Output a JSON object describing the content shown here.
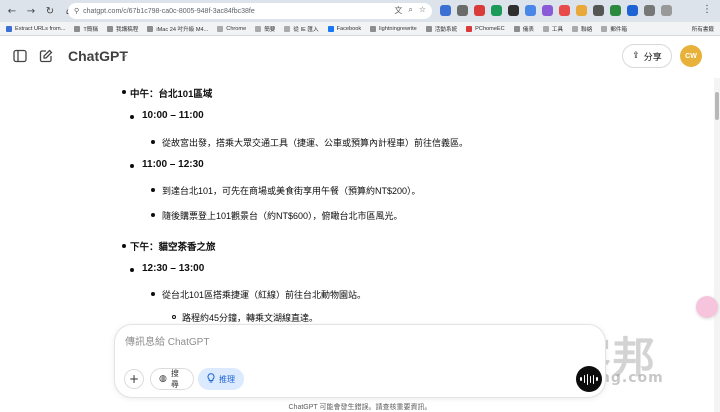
{
  "browser": {
    "url": "chatgpt.com/c/67b1c798-ca0c-8005-948f-3ac84fbc38fe",
    "bookmarks": [
      "Extract URLs from...",
      "T簡稱",
      "我講稿程",
      "iMac 24 吋升級 M4...",
      "Chrome",
      "簡要",
      "從 IE 匯入",
      "Facebook",
      "lightningrewrite",
      "活動系統",
      "PChomeEC",
      "儀表",
      "工具",
      "聯絡",
      "郵件箱"
    ],
    "all_bookmarks": "所有書籤"
  },
  "app": {
    "brand": "ChatGPT",
    "share_label": "分享",
    "avatar_initials": "CW"
  },
  "content": {
    "noon_title": "中午：台北101區域",
    "slot1_time": "10:00 – 11:00",
    "slot1_item1": "從故宮出發，搭乘大眾交通工具（捷運、公車或預算內計程車）前往信義區。",
    "slot2_time": "11:00 – 12:30",
    "slot2_item1": "到達台北101，可先在商場或美食街享用午餐（預算約NT$200）。",
    "slot2_item2": "隨後購票登上101觀景台（約NT$600），俯瞰台北市區風光。",
    "afternoon_title": "下午：貓空茶香之旅",
    "slot3_time": "12:30 – 13:00",
    "slot3_item1": "從台北101區搭乘捷運（紅線）前往台北動物園站。",
    "slot3_sub1": "路程約45分鐘，轉乘文湖線直達。"
  },
  "composer": {
    "placeholder": "傳訊息給 ChatGPT",
    "search_label": "搜尋",
    "reason_label": "推理"
  },
  "disclaimer": "ChatGPT 可能會發生錯誤。請查核重要資訊。",
  "watermark": {
    "big": "T客邦",
    "small": "techbang.com"
  },
  "colors": {
    "avatar": "#e8b23a",
    "reason_pill_bg": "#dbeafe",
    "reason_pill_text": "#1d63d3"
  }
}
